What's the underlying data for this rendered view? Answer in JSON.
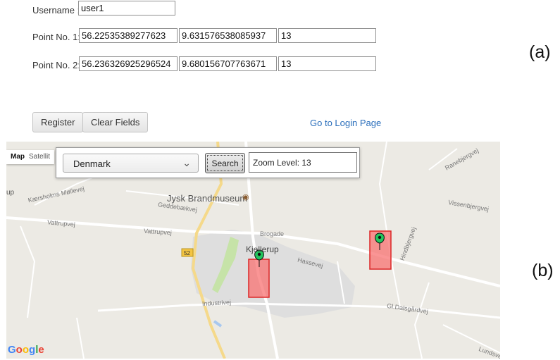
{
  "form": {
    "username_label": "Username :",
    "username_value": "user1",
    "point1_label": "Point No. 1:",
    "point1_lat": "56.22535389277623",
    "point1_lng": "9.631576538085937",
    "point1_zoom": "13",
    "point2_label": "Point No. 2:",
    "point2_lat": "56.236326925296524",
    "point2_lng": "9.680156707763671",
    "point2_zoom": "13",
    "register_label": "Register",
    "clear_label": "Clear Fields",
    "login_link": "Go to Login Page"
  },
  "captions": {
    "a": "(a)",
    "b": "(b)"
  },
  "map": {
    "type_map": "Map",
    "type_satellite": "Satellit",
    "country": "Denmark",
    "search_label": "Search",
    "zoom_text": "Zoom Level: 13",
    "town": "Kjellerup",
    "poi": "Jysk Brandmuseum",
    "route_shield": "52",
    "google": "Google",
    "roads": {
      "vattrupvej1": "Vattrupvej",
      "vattrupvej2": "Vattrupvej",
      "brogade": "Brogade",
      "industrivej": "Industrivej",
      "hassevej": "Hassevej",
      "gl_dalsgardvej": "Gl.Dalsgårdvej",
      "gedebaekvej": "Geddebækvej",
      "kaersholms": "Kærsholms Møllevej",
      "vissenbjerg": "Vissenbjergvej",
      "ranebjergvej": "Ranebjergvej",
      "hindbjergvej": "Hindbjergvej",
      "lundsvej": "Lundsvej",
      "up": "up"
    }
  },
  "colors": {
    "marker": "#22c55e",
    "rect_fill": "#f87171",
    "rect_stroke": "#dc2626",
    "link": "#2a6ebb"
  }
}
